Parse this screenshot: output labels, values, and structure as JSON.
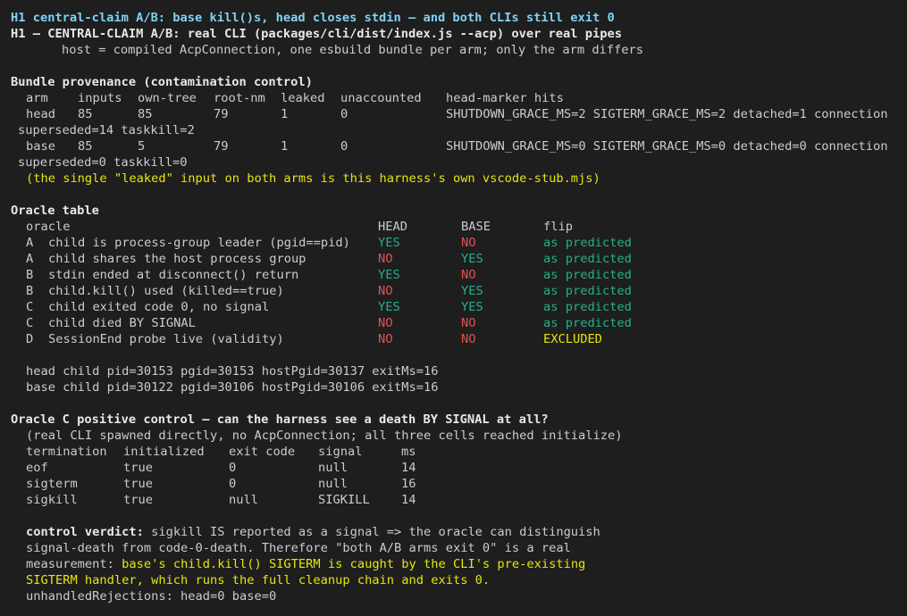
{
  "header": {
    "title": "H1 central-claim A/B: base kill()s, head closes stdin — and both CLIs still exit 0",
    "subtitle": "H1 — CENTRAL-CLAIM A/B: real CLI (packages/cli/dist/index.js --acp) over real pipes",
    "host_line": "host = compiled AcpConnection, one esbuild bundle per arm; only the arm differs"
  },
  "provenance": {
    "heading": "Bundle provenance (contamination control)",
    "columns": [
      "arm",
      "inputs",
      "own-tree",
      "root-nm",
      "leaked",
      "unaccounted",
      "head-marker hits"
    ],
    "rows": [
      {
        "arm": "head",
        "inputs": "85",
        "own_tree": "85",
        "root_nm": "79",
        "leaked": "1",
        "unaccounted": "0",
        "markers": "SHUTDOWN_GRACE_MS=2 SIGTERM_GRACE_MS=2 detached=1 connection",
        "wrap": "superseded=14 taskkill=2"
      },
      {
        "arm": "base",
        "inputs": "85",
        "own_tree": "5",
        "root_nm": "79",
        "leaked": "1",
        "unaccounted": "0",
        "markers": "SHUTDOWN_GRACE_MS=0 SIGTERM_GRACE_MS=0 detached=0 connection",
        "wrap": "superseded=0 taskkill=0"
      }
    ],
    "note": "(the single \"leaked\" input on both arms is this harness's own vscode-stub.mjs)"
  },
  "oracle": {
    "heading": "Oracle table",
    "columns": [
      "oracle",
      "HEAD",
      "BASE",
      "flip"
    ],
    "rows": [
      {
        "id": "A",
        "label": "child is process-group leader (pgid==pid)",
        "head": "YES",
        "base": "NO",
        "flip": "as predicted"
      },
      {
        "id": "A",
        "label": "child shares the host process group",
        "head": "NO",
        "base": "YES",
        "flip": "as predicted"
      },
      {
        "id": "B",
        "label": "stdin ended at disconnect() return",
        "head": "YES",
        "base": "NO",
        "flip": "as predicted"
      },
      {
        "id": "B",
        "label": "child.kill() used (killed==true)",
        "head": "NO",
        "base": "YES",
        "flip": "as predicted"
      },
      {
        "id": "C",
        "label": "child exited code 0, no signal",
        "head": "YES",
        "base": "YES",
        "flip": "as predicted"
      },
      {
        "id": "C",
        "label": "child died BY SIGNAL",
        "head": "NO",
        "base": "NO",
        "flip": "as predicted"
      },
      {
        "id": "D",
        "label": "SessionEnd probe live (validity)",
        "head": "NO",
        "base": "NO",
        "flip": "EXCLUDED"
      }
    ],
    "pids": [
      "head child pid=30153 pgid=30153 hostPgid=30137 exitMs=16",
      "base child pid=30122 pgid=30106 hostPgid=30106 exitMs=16"
    ]
  },
  "control": {
    "heading": "Oracle C positive control — can the harness see a death BY SIGNAL at all?",
    "sub": "(real CLI spawned directly, no AcpConnection; all three cells reached initialize)",
    "columns": [
      "termination",
      "initialized",
      "exit code",
      "signal",
      "ms"
    ],
    "rows": [
      {
        "termination": "eof",
        "initialized": "true",
        "exit_code": "0",
        "signal": "null",
        "ms": "14"
      },
      {
        "termination": "sigterm",
        "initialized": "true",
        "exit_code": "0",
        "signal": "null",
        "ms": "16"
      },
      {
        "termination": "sigkill",
        "initialized": "true",
        "exit_code": "null",
        "signal": "SIGKILL",
        "ms": "14"
      }
    ],
    "verdict_label": "control verdict:",
    "verdict_line1": " sigkill IS reported as a signal => the oracle can distinguish",
    "verdict_line2": "signal-death from code-0-death. Therefore \"both A/B arms exit 0\" is a real",
    "verdict_line3a": "measurement: ",
    "verdict_line3b": "base's child.kill() SIGTERM is caught by the CLI's pre-existing",
    "verdict_line4": "SIGTERM handler, which runs the full cleanup chain and exits 0.",
    "unhandled": "unhandledRejections: head=0 base=0"
  },
  "colors": {
    "background": "#1e1e1e",
    "title": "#7fd3f5",
    "yes": "#23b08b",
    "no": "#e05252",
    "predicted": "#23b08b",
    "excluded": "#e5e510",
    "note": "#e5e510"
  }
}
